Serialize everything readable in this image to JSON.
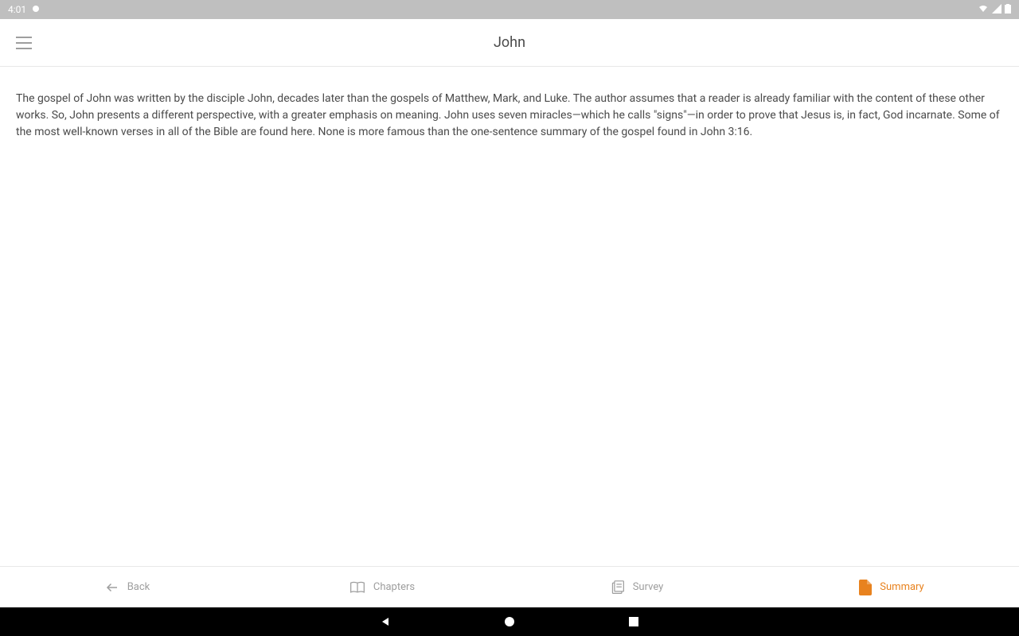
{
  "statusBar": {
    "time": "4:01",
    "notificationIcon": "●"
  },
  "header": {
    "title": "John"
  },
  "content": {
    "summaryText": "The gospel of John was written by the disciple John, decades later than the gospels of Matthew, Mark, and Luke. The author assumes that a reader is already familiar with the content of these other works. So, John presents a different perspective, with a greater emphasis on meaning. John uses seven miracles—which he calls \"signs\"—in order to prove that Jesus is, in fact, God incarnate. Some of the most well-known verses in all of the Bible are found here. None is more famous than the one-sentence summary of the gospel found in John 3:16."
  },
  "bottomNav": {
    "items": [
      {
        "label": "Back",
        "icon": "arrow-back",
        "active": false
      },
      {
        "label": "Chapters",
        "icon": "book-open",
        "active": false
      },
      {
        "label": "Survey",
        "icon": "books",
        "active": false
      },
      {
        "label": "Summary",
        "icon": "document",
        "active": true
      }
    ]
  }
}
